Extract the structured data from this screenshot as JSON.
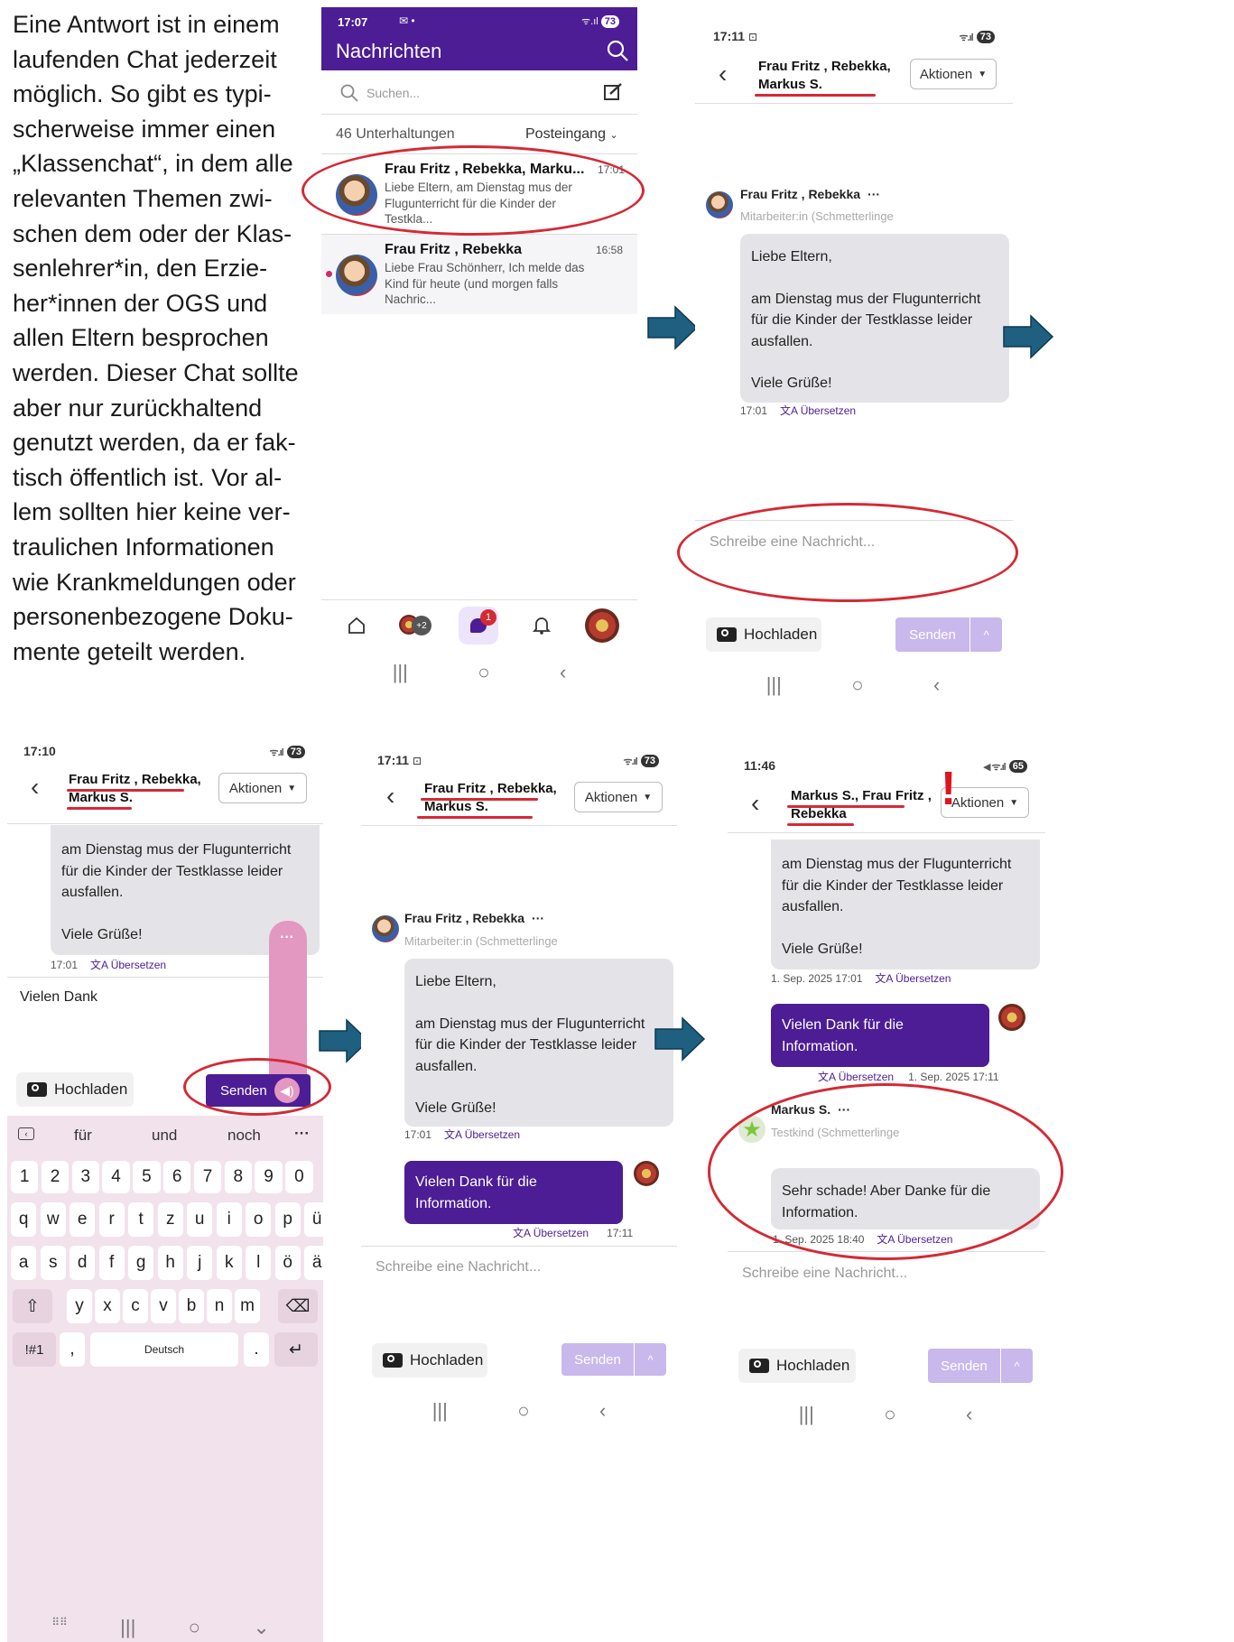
{
  "intro": {
    "lines": [
      "Eine Antwort ist in einem",
      "laufenden Chat jederzeit",
      "möglich. So gibt es typi-",
      "scherweise immer einen",
      "„Klassenchat“, in dem alle",
      "relevanten Themen zwi-",
      "schen dem oder der Klas-",
      "senlehrer*in, den Erzie-",
      "her*innen der OGS und",
      "allen Eltern besprochen",
      "werden. Dieser Chat sollte",
      "aber nur zurückhaltend",
      "genutzt werden, da er fak-",
      "tisch öffentlich ist. Vor al-",
      "lem sollten hier keine ver-",
      "traulichen Informationen",
      "wie Krankmeldungen oder",
      "personenbezogene Doku-",
      "mente geteilt werden."
    ]
  },
  "colors": {
    "accent": "#4c1d95",
    "highlight": "#d42a35",
    "arrow": "#1f5f7f",
    "send_disabled": "#c9b8ec"
  },
  "common": {
    "actions_label": "Aktionen",
    "upload_label": "Hochladen",
    "send_label": "Senden",
    "placeholder": "Schreibe eine Nachricht...",
    "translate": "Übersetzen",
    "chat_names_1": "Frau Fritz , Rebekka,",
    "chat_names_2": "Markus S.",
    "sender": "Frau Fritz , Rebekka",
    "role": "Mitarbeiter:in (Schmetterlinge",
    "msg_greeting": "Liebe Eltern,",
    "msg_body": "am Dienstag mus der Flugunterricht für die Kinder der Testklasse leider ausfallen.",
    "msg_bye": "Viele Grüße!",
    "reply": "Vielen Dank für die Information."
  },
  "screen1": {
    "time": "17:07",
    "battery": "73",
    "title": "Nachrichten",
    "search_placeholder": "Suchen...",
    "count": "46 Unterhaltungen",
    "filter": "Posteingang",
    "convs": [
      {
        "name": "Frau Fritz , Rebekka, Marku...",
        "time": "17:01",
        "preview": "Liebe Eltern, am Dienstag mus der Flugunterricht für die Kinder der Testkla..."
      },
      {
        "name": "Frau Fritz , Rebekka",
        "time": "16:58",
        "preview": "Liebe Frau Schönherr, Ich melde das Kind für heute (und morgen falls Nachric..."
      }
    ],
    "badge": "1",
    "group_count": "+2"
  },
  "screen2": {
    "time": "17:11",
    "battery": "73",
    "msg_time": "17:01"
  },
  "screen3": {
    "time": "17:10",
    "battery": "73",
    "msg_time": "17:01",
    "typed": "Vielen Dank",
    "suggestions": [
      "für",
      "und",
      "noch"
    ],
    "row_numbers": [
      "1",
      "2",
      "3",
      "4",
      "5",
      "6",
      "7",
      "8",
      "9",
      "0"
    ],
    "row_top": [
      "q",
      "w",
      "e",
      "r",
      "t",
      "z",
      "u",
      "i",
      "o",
      "p",
      "ü"
    ],
    "row_mid": [
      "a",
      "s",
      "d",
      "f",
      "g",
      "h",
      "j",
      "k",
      "l",
      "ö",
      "ä"
    ],
    "row_bot": [
      "y",
      "x",
      "c",
      "v",
      "b",
      "n",
      "m"
    ],
    "sym": "!#1",
    "comma": ",",
    "space": "Deutsch",
    "period": "."
  },
  "screen4": {
    "time": "17:11",
    "battery": "73",
    "msg_time": "17:01",
    "reply_time": "17:11"
  },
  "screen5": {
    "time": "11:46",
    "battery": "65",
    "names_1": "Markus S., Frau Fritz ,",
    "names_2": "Rebekka",
    "msg_time": "1. Sep. 2025 17:01",
    "reply_time": "1. Sep. 2025 17:11",
    "sender2": "Markus S.",
    "role2": "Testkind (Schmetterlinge",
    "msg2": "Sehr schade! Aber Danke für die Information.",
    "msg2_time": "1. Sep. 2025 18:40",
    "exclaim": "!"
  }
}
